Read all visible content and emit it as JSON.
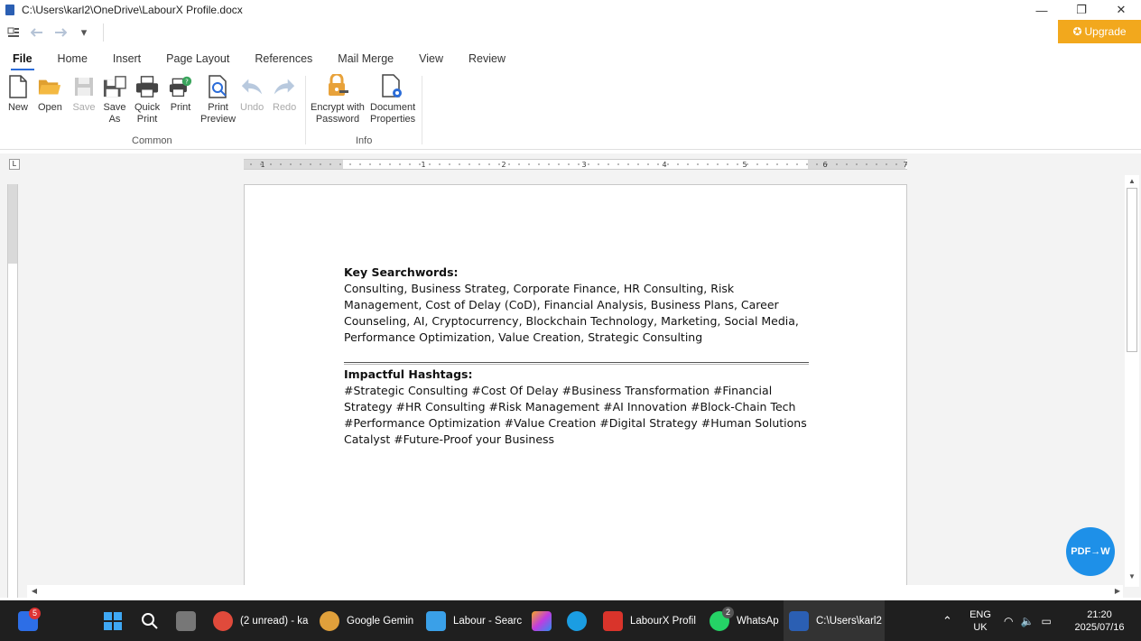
{
  "window": {
    "title": "C:\\Users\\karl2\\OneDrive\\LabourX Profile.docx",
    "minimize": "—",
    "restore": "❐",
    "close": "✕"
  },
  "qat": {
    "customize": "▾"
  },
  "upgrade_label": "Upgrade",
  "tabs": [
    "File",
    "Home",
    "Insert",
    "Page Layout",
    "References",
    "Mail Merge",
    "View",
    "Review"
  ],
  "ribbon": {
    "buttons": {
      "new": "New",
      "open": "Open",
      "save": "Save",
      "save_as": [
        "Save",
        "As"
      ],
      "quick_print": [
        "Quick",
        "Print"
      ],
      "print": "Print",
      "print_preview": [
        "Print",
        "Preview"
      ],
      "undo": "Undo",
      "redo": "Redo",
      "encrypt": [
        "Encrypt with",
        "Password"
      ],
      "doc_props": [
        "Document",
        "Properties"
      ]
    },
    "groups": {
      "common": "Common",
      "info": "Info"
    }
  },
  "ruler_numbers": [
    "1",
    "1",
    "2",
    "3",
    "4",
    "5",
    "6",
    "7"
  ],
  "document": {
    "keywords_heading": "Key Searchwords:",
    "keywords_text": "Consulting, Business Strateg, Corporate Finance, HR Consulting, Risk Management, Cost of Delay (CoD), Financial Analysis, Business Plans, Career Counseling, AI, Cryptocurrency, Blockchain Technology, Marketing, Social Media, Performance Optimization, Value Creation, Strategic Consulting",
    "hashtags_heading": "Impactful Hashtags:",
    "hashtags_text": "#Strategic Consulting  #Cost Of Delay #Business Transformation #Financial Strategy #HR Consulting #Risk Management #AI Innovation #Block-Chain Tech #Performance Optimization #Value Creation #Digital Strategy #Human Solutions Catalyst  #Future-Proof your Business"
  },
  "converter_badge": "PDF→W",
  "taskbar": {
    "items": [
      {
        "label": "(2 unread) - ka"
      },
      {
        "label": "Google Gemin"
      },
      {
        "label": "Labour - Searc"
      },
      {
        "label": "LabourX Profil"
      },
      {
        "label": "WhatsAp"
      },
      {
        "label": "C:\\Users\\karl2"
      }
    ],
    "badge_weather": "5",
    "badge_whatsapp": "2",
    "lang": "ENG",
    "region": "UK",
    "time": "21:20",
    "date": "2025/07/16"
  },
  "colors": {
    "accent": "#2b6cd8",
    "upgrade": "#f2a81d",
    "taskbar": "#1f1f1f",
    "converter": "#1e90e8"
  }
}
